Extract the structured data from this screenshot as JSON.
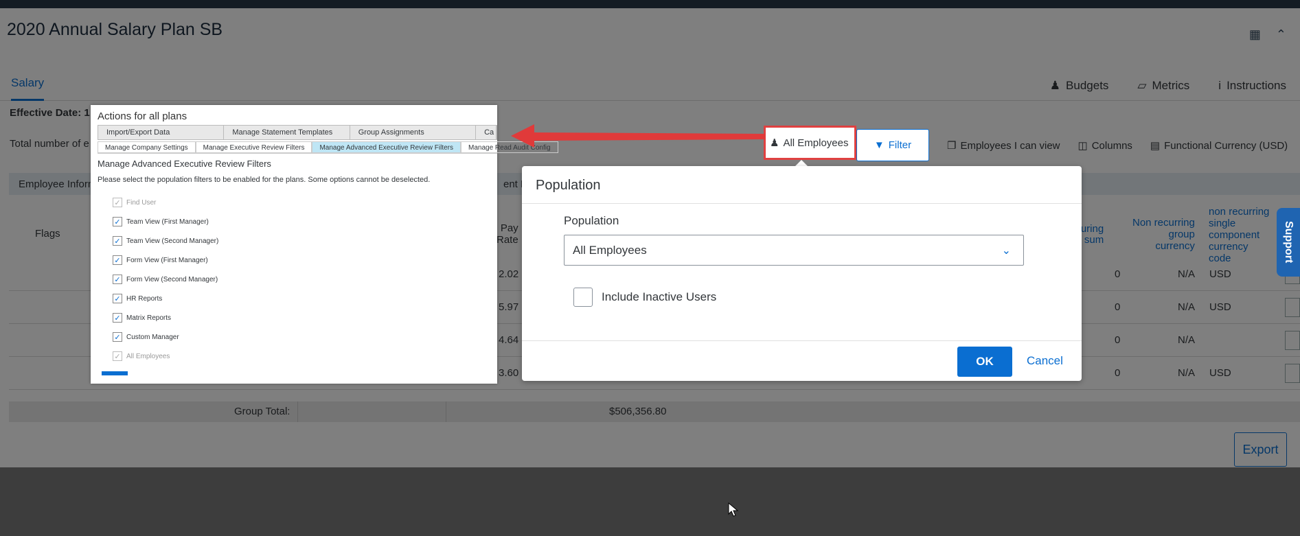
{
  "page": {
    "title": "2020 Annual Salary Plan SB",
    "tab_salary": "Salary",
    "tab_links": {
      "budgets": "Budgets",
      "metrics": "Metrics",
      "instructions": "Instructions"
    },
    "effective_date": "Effective Date: 1",
    "total_employees": "Total number of e",
    "toolbar": {
      "all_employees": "All Employees",
      "filter": "Filter",
      "employees_i_can_view": "Employees I can view",
      "columns": "Columns",
      "functional_currency": "Functional Currency (USD)"
    },
    "grid": {
      "employee_info": "Employee Inform",
      "comp_pay": "ent Pa",
      "flags": "Flags",
      "pay_rate": [
        "Pay",
        "Rate"
      ],
      "nonrec_sum": [
        "recuring",
        "up sum"
      ],
      "nonrec_group": [
        "Non recurring",
        "group",
        "currency"
      ],
      "nonrec_single": [
        "non recurring",
        "single",
        "component",
        "currency",
        "code"
      ],
      "rows": [
        {
          "pay": "2.02",
          "zero": "0",
          "na": "N/A",
          "cur": "USD"
        },
        {
          "pay": "5.97",
          "zero": "0",
          "na": "N/A",
          "cur": "USD"
        },
        {
          "pay": "4.64",
          "zero": "0",
          "na": "N/A",
          "cur": ""
        },
        {
          "pay": "3.60",
          "zero": "0",
          "na": "N/A",
          "cur": "USD"
        }
      ],
      "group_total_label": "Group Total:",
      "group_total_value": "$506,356.80"
    },
    "export": "Export",
    "support": "Support"
  },
  "inset": {
    "title": "Actions for all plans",
    "tabs1": [
      "Import/Export Data",
      "Manage Statement Templates",
      "Group Assignments",
      "Ca"
    ],
    "tabs2": [
      "Manage Company Settings",
      "Manage Executive Review Filters",
      "Manage Advanced Executive Review Filters",
      "Manage Read Audit Config"
    ],
    "heading": "Manage Advanced Executive Review Filters",
    "description": "Please select the population filters to be enabled for the plans. Some options cannot be deselected.",
    "items": [
      {
        "label": "Find User",
        "disabled": true
      },
      {
        "label": "Team View (First Manager)",
        "disabled": false
      },
      {
        "label": "Team View (Second Manager)",
        "disabled": false
      },
      {
        "label": "Form View (First Manager)",
        "disabled": false
      },
      {
        "label": "Form View (Second Manager)",
        "disabled": false
      },
      {
        "label": "HR Reports",
        "disabled": false
      },
      {
        "label": "Matrix Reports",
        "disabled": false
      },
      {
        "label": "Custom Manager",
        "disabled": false
      },
      {
        "label": "All Employees",
        "disabled": true
      }
    ]
  },
  "dialog": {
    "title": "Population",
    "field_label": "Population",
    "selected": "All Employees",
    "include_inactive": "Include Inactive Users",
    "ok": "OK",
    "cancel": "Cancel"
  }
}
